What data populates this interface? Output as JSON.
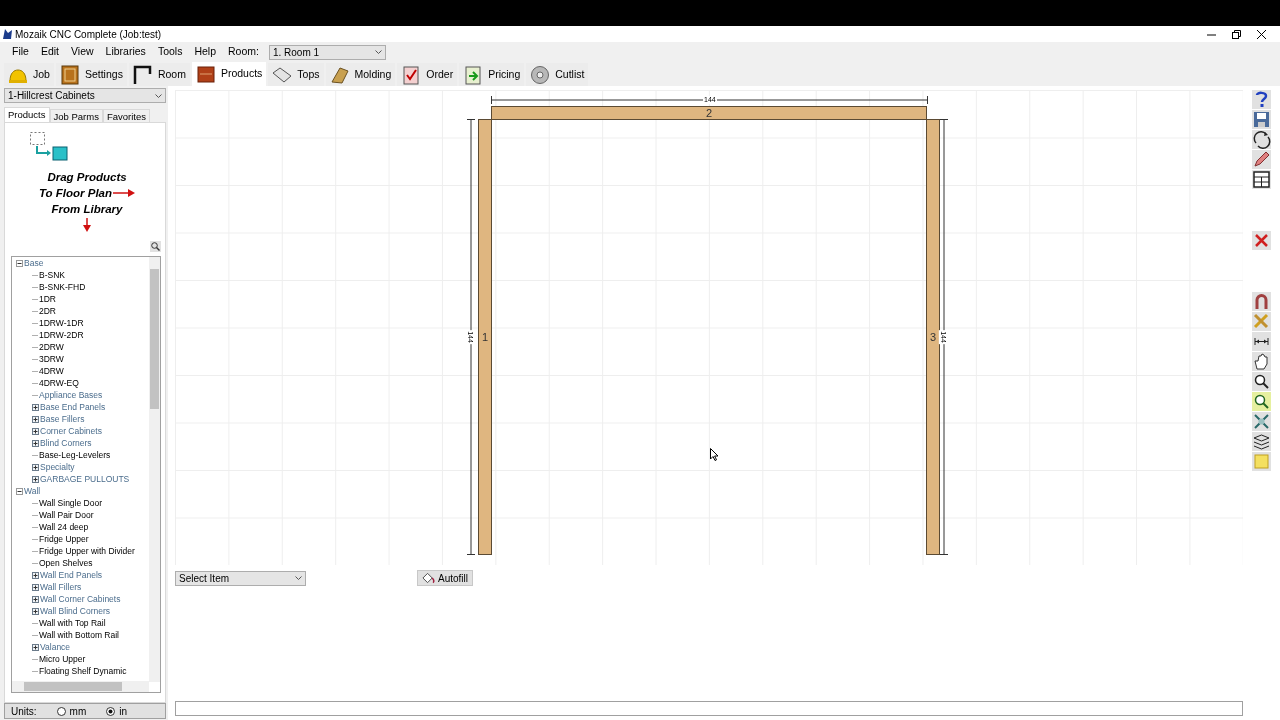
{
  "window": {
    "title": "Mozaik CNC Complete (Job:test)"
  },
  "menu": [
    "File",
    "Edit",
    "View",
    "Libraries",
    "Tools",
    "Help"
  ],
  "room": {
    "label": "Room:",
    "value": "1. Room 1"
  },
  "tabs": [
    {
      "label": "Job",
      "selected": false
    },
    {
      "label": "Settings",
      "selected": false
    },
    {
      "label": "Room",
      "selected": false
    },
    {
      "label": "Products",
      "selected": true
    },
    {
      "label": "Tops",
      "selected": false
    },
    {
      "label": "Molding",
      "selected": false
    },
    {
      "label": "Order",
      "selected": false
    },
    {
      "label": "Pricing",
      "selected": false
    },
    {
      "label": "Cutlist",
      "selected": false
    }
  ],
  "library": {
    "value": "1-Hillcrest Cabinets"
  },
  "panel_tabs": [
    {
      "label": "Products",
      "selected": true
    },
    {
      "label": "Job Parms",
      "selected": false
    },
    {
      "label": "Favorites",
      "selected": false
    }
  ],
  "hint": [
    "Drag Products",
    "To Floor Plan",
    "From Library"
  ],
  "tree": [
    {
      "label": "Base",
      "kind": "category",
      "expanded": true,
      "children": [
        {
          "label": "B-SNK",
          "kind": "product"
        },
        {
          "label": "B-SNK-FHD",
          "kind": "product"
        },
        {
          "label": "1DR",
          "kind": "product"
        },
        {
          "label": "2DR",
          "kind": "product"
        },
        {
          "label": "1DRW-1DR",
          "kind": "product"
        },
        {
          "label": "1DRW-2DR",
          "kind": "product"
        },
        {
          "label": "2DRW",
          "kind": "product"
        },
        {
          "label": "3DRW",
          "kind": "product"
        },
        {
          "label": "4DRW",
          "kind": "product"
        },
        {
          "label": "4DRW-EQ",
          "kind": "product"
        },
        {
          "label": "Appliance Bases",
          "kind": "category"
        },
        {
          "label": "Base End Panels",
          "kind": "category",
          "expanded": false
        },
        {
          "label": "Base Fillers",
          "kind": "category",
          "expanded": false
        },
        {
          "label": "Corner Cabinets",
          "kind": "category",
          "expanded": false
        },
        {
          "label": "Blind Corners",
          "kind": "category",
          "expanded": false
        },
        {
          "label": "Base-Leg-Levelers",
          "kind": "product"
        },
        {
          "label": "Specialty",
          "kind": "category",
          "expanded": false
        },
        {
          "label": "GARBAGE PULLOUTS",
          "kind": "category",
          "expanded": false
        }
      ]
    },
    {
      "label": "Wall",
      "kind": "category",
      "expanded": true,
      "children": [
        {
          "label": "Wall Single Door",
          "kind": "product"
        },
        {
          "label": "Wall Pair Door",
          "kind": "product"
        },
        {
          "label": "Wall 24 deep",
          "kind": "product"
        },
        {
          "label": "Fridge Upper",
          "kind": "product"
        },
        {
          "label": "Fridge Upper with Divider",
          "kind": "product"
        },
        {
          "label": "Open Shelves",
          "kind": "product"
        },
        {
          "label": "Wall End Panels",
          "kind": "category",
          "expanded": false
        },
        {
          "label": "Wall Fillers",
          "kind": "category",
          "expanded": false
        },
        {
          "label": "Wall Corner Cabinets",
          "kind": "category",
          "expanded": false
        },
        {
          "label": "Wall Blind Corners",
          "kind": "category",
          "expanded": false
        },
        {
          "label": "Wall with Top Rail",
          "kind": "product"
        },
        {
          "label": "Wall with Bottom Rail",
          "kind": "product"
        },
        {
          "label": "Valance",
          "kind": "category",
          "expanded": false
        },
        {
          "label": "Micro Upper",
          "kind": "product"
        },
        {
          "label": "Floating Shelf Dynamic",
          "kind": "product"
        }
      ]
    }
  ],
  "units": {
    "label": "Units:",
    "options": [
      {
        "label": "mm",
        "selected": false
      },
      {
        "label": "in",
        "selected": true
      }
    ]
  },
  "drawing": {
    "width_dimension": "144",
    "side_dimensions": [
      "144",
      "144"
    ],
    "parts": [
      {
        "label": "1",
        "kind": "left"
      },
      {
        "label": "2",
        "kind": "top"
      },
      {
        "label": "3",
        "kind": "right"
      }
    ]
  },
  "select_item": {
    "value": "Select Item"
  },
  "autofill": "Autofill"
}
